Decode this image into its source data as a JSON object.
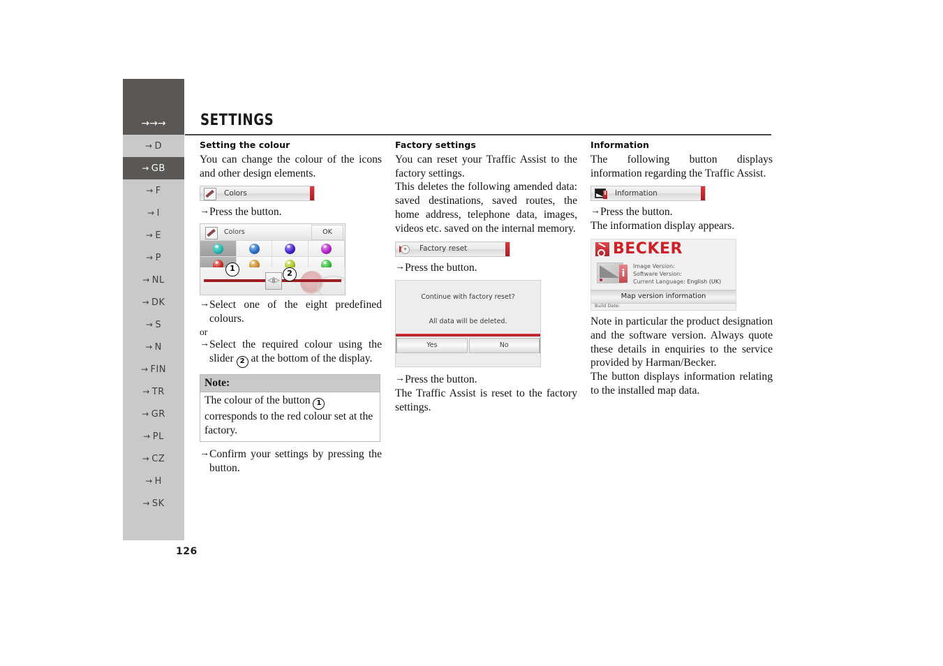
{
  "header": {
    "title": "SETTINGS",
    "arrows": "→→→"
  },
  "page_number": "126",
  "sidebar": {
    "items": [
      {
        "label": "D",
        "active": false
      },
      {
        "label": "GB",
        "active": true
      },
      {
        "label": "F",
        "active": false
      },
      {
        "label": "I",
        "active": false
      },
      {
        "label": "E",
        "active": false
      },
      {
        "label": "P",
        "active": false
      },
      {
        "label": "NL",
        "active": false
      },
      {
        "label": "DK",
        "active": false
      },
      {
        "label": "S",
        "active": false
      },
      {
        "label": "N",
        "active": false
      },
      {
        "label": "FIN",
        "active": false
      },
      {
        "label": "TR",
        "active": false
      },
      {
        "label": "GR",
        "active": false
      },
      {
        "label": "PL",
        "active": false
      },
      {
        "label": "CZ",
        "active": false
      },
      {
        "label": "H",
        "active": false
      },
      {
        "label": "SK",
        "active": false
      }
    ],
    "arrow_glyph": "→"
  },
  "col1": {
    "heading": "Setting the colour",
    "intro": "You can change the colour of the icons and other design elements.",
    "colors_bar_label": "Colors",
    "press_button_step": "Press the                 button.",
    "dialog": {
      "title": "Colors",
      "ok_label": "OK",
      "knob_glyph": "◁|▷",
      "swatches": [
        {
          "name": "teal",
          "hex": "#25b7b0",
          "selected": true
        },
        {
          "name": "blue",
          "hex": "#2a6fc4",
          "selected": false
        },
        {
          "name": "indigo",
          "hex": "#4621c9",
          "selected": false
        },
        {
          "name": "magenta",
          "hex": "#b321c9",
          "selected": false
        },
        {
          "name": "red",
          "hex": "#c62a23",
          "selected": true
        },
        {
          "name": "orange",
          "hex": "#cf8a2c",
          "selected": false
        },
        {
          "name": "lime",
          "hex": "#a9c423",
          "selected": false
        },
        {
          "name": "green",
          "hex": "#35b83a",
          "selected": false
        }
      ],
      "slider_color": "#9d1f25"
    },
    "step_select_predefined": "Select one of the eight predefined colours.",
    "or": "or",
    "step_slider_a": "Select the required colour using the slider ",
    "step_slider_b": " at the bottom of the display.",
    "callout_1": "1",
    "callout_2": "2",
    "note": {
      "title": "Note:",
      "body_a": "The colour of the button ",
      "body_b": " corresponds to the red colour set at the factory."
    },
    "step_confirm": "Confirm your settings by pressing the                button."
  },
  "col2": {
    "heading": "Factory settings",
    "para1": "You can reset your Traffic Assist to the factory settings.",
    "para2": "This deletes the following amended data: saved destinations, saved routes, the home address, telephone data, images, videos etc. saved on the internal memory.",
    "reset_bar_label": "Factory reset",
    "press_button_step": "Press the                      button.",
    "dialog": {
      "line1": "Continue with factory reset?",
      "line2": "All data will be deleted.",
      "yes_label": "Yes",
      "no_label": "No"
    },
    "press_yes_step": "Press the          button.",
    "para3": "The Traffic Assist is reset to the factory settings."
  },
  "col3": {
    "heading": "Information",
    "para1": "The following button displays information regarding the Traffic Assist.",
    "info_bar_label": "Information",
    "press_button_step": "Press the                    button.",
    "after_press": "The information display appears.",
    "info_screen": {
      "brand": "BECKER",
      "image_version_label": "Image Version:",
      "software_version_label": "Software Version:",
      "current_language_label": "Current Language:",
      "current_language_value": "English (UK)",
      "map_button_label": "Map version information",
      "build_date_label": "Build Date:"
    },
    "para2": "Note in particular the product designation and the software version. Always quote these details in enquiries to the service provided by Harman/Becker.",
    "para3": "The                              button displays information relating to the installed map data."
  },
  "colors": {
    "sidebar_bg": "#c9c9c9",
    "sidebar_active": "#595857",
    "rule": "#4a4748",
    "accent_red": "#b4212a",
    "note_header": "#c9c9c9"
  }
}
